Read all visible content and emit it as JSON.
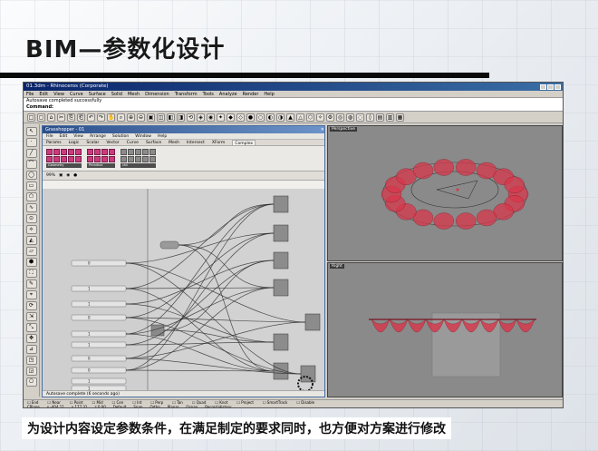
{
  "slide": {
    "title": "BIM—参数化设计",
    "caption": "为设计内容设定参数条件，在满足制定的要求同时，也方便对方案进行修改"
  },
  "rhino": {
    "window_title": "01.3dm - Rhinoceros (Corporate)",
    "menu": [
      "File",
      "Edit",
      "View",
      "Curve",
      "Surface",
      "Solid",
      "Mesh",
      "Dimension",
      "Transform",
      "Tools",
      "Analyze",
      "Render",
      "Help"
    ],
    "command_history": "Autosave completed successfully",
    "command_prompt": "Command:",
    "osnap": [
      "End",
      "Near",
      "Point",
      "Mid",
      "Cen",
      "Int",
      "Perp",
      "Tan",
      "Quad",
      "Knot",
      "Project",
      "SmartTrack",
      "Disable"
    ],
    "status": [
      "CPlane",
      "x -404.11",
      "y 177.31",
      "z 0.00",
      "Default",
      "Snap",
      "Ortho",
      "Planar",
      "Osnap",
      "Record History"
    ]
  },
  "grasshopper": {
    "window_title": "Grasshopper - 01",
    "menu": [
      "File",
      "Edit",
      "View",
      "Arrange",
      "Solution",
      "Window",
      "Help"
    ],
    "tabs": [
      "Params",
      "Logic",
      "Scalar",
      "Vector",
      "Curve",
      "Surface",
      "Mesh",
      "Intersect",
      "XForm",
      "Complex"
    ],
    "active_tab": "Complex",
    "group_labels": [
      "Geometry",
      "Primitive",
      "Util"
    ],
    "file_label": "99%",
    "status_text": "Autosave complete (6 seconds ago)",
    "sliders": [
      "0",
      "1",
      "1",
      "0",
      "1",
      "1",
      "0",
      "0",
      "1",
      "1"
    ]
  },
  "viewports": {
    "top_label": "Perspective",
    "bottom_label": "Right"
  },
  "colors": {
    "accent": "#d8364a",
    "title_bar": "#0a246a"
  }
}
